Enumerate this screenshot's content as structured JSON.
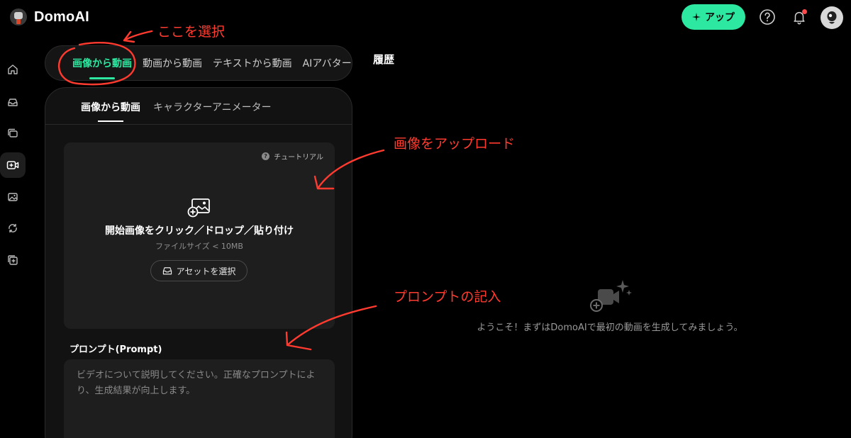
{
  "app": {
    "name": "DomoAI"
  },
  "header": {
    "upgrade_label": "アップ",
    "colors": {
      "accent": "#2de8a0",
      "notification_dot": "#ff4b4b"
    },
    "icons": [
      "help-icon",
      "bell-icon",
      "avatar"
    ]
  },
  "sidebar": {
    "icons": [
      "home-icon",
      "inbox-icon",
      "gallery-icon",
      "video-camera-icon",
      "image-icon",
      "transform-icon",
      "add-layer-icon"
    ],
    "active": "video-camera-icon"
  },
  "top_tabs": {
    "items": [
      {
        "label": "画像から動画",
        "active": true
      },
      {
        "label": "動画から動画",
        "active": false
      },
      {
        "label": "テキストから動画",
        "active": false
      },
      {
        "label": "AIアバター",
        "active": false
      }
    ]
  },
  "history": {
    "title": "履歴"
  },
  "panel": {
    "sub_tabs": [
      {
        "label": "画像から動画",
        "active": true
      },
      {
        "label": "キャラクターアニメーター",
        "active": false
      }
    ],
    "upload": {
      "tutorial": "チュートリアル",
      "title": "開始画像をクリック／ドロップ／貼り付け",
      "hint": "ファイルサイズ < 10MB",
      "asset_button": "アセットを選択"
    },
    "prompt": {
      "label": "プロンプト(Prompt)",
      "placeholder": "ビデオについて説明してください。正確なプロンプトにより、生成結果が向上します。"
    }
  },
  "empty_state": {
    "message": "ようこそ！まずはDomoAIで最初の動画を生成してみましょう。"
  },
  "annotations": {
    "select_here": "ここを選択",
    "upload_image": "画像をアップロード",
    "enter_prompt": "プロンプトの記入",
    "color": "#ff3b30"
  }
}
